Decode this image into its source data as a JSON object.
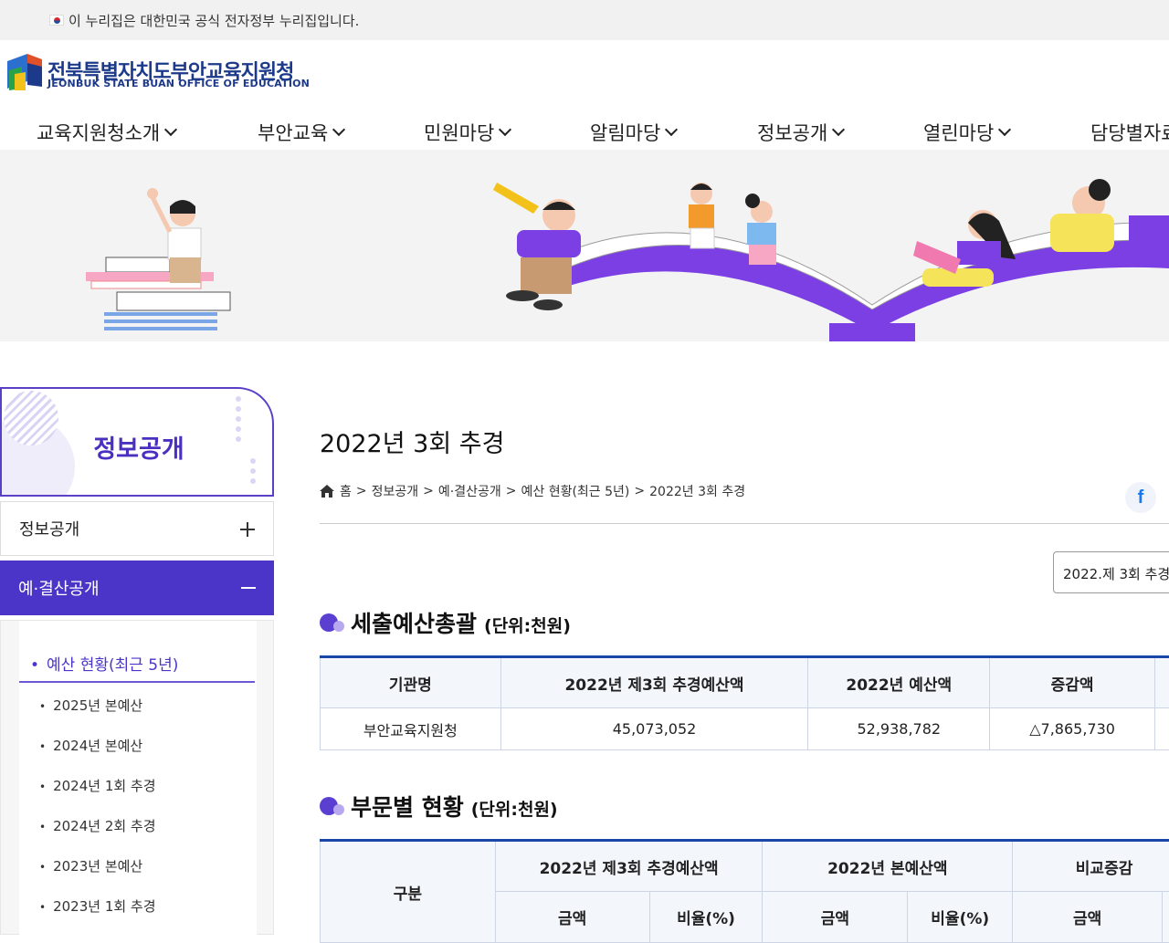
{
  "gov_banner": {
    "text": "이 누리집은 대한민국 공식 전자정부 누리집입니다."
  },
  "logo": {
    "name": "전북특별자치도부안교육지원청",
    "name_en": "JEONBUK STATE BUAN OFFICE OF EDUCATION"
  },
  "gnb": [
    {
      "label": "교육지원청소개"
    },
    {
      "label": "부안교육"
    },
    {
      "label": "민원마당"
    },
    {
      "label": "알림마당"
    },
    {
      "label": "정보공개"
    },
    {
      "label": "열린마당"
    },
    {
      "label": "담당별자료"
    }
  ],
  "lnb": {
    "title": "정보공개",
    "depth1": {
      "label": "정보공개"
    },
    "depth1_active": {
      "label": "예·결산공개"
    },
    "sub_active": "예산 현황(최근 5년)",
    "sub_items": [
      "2025년 본예산",
      "2024년 본예산",
      "2024년 1회 추경",
      "2024년 2회 추경",
      "2023년 본예산",
      "2023년 1회 추경"
    ]
  },
  "page": {
    "title": "2022년 3회 추경",
    "breadcrumb": [
      "홈",
      "정보공개",
      "예·결산공개",
      "예산 현황(최근 5년)",
      "2022년 3회 추경"
    ],
    "facebook_glyph": "f",
    "select_value": "2022.제 3회 추경"
  },
  "section1": {
    "title": "세출예산총괄",
    "unit": "(단위:천원)",
    "headers": [
      "기관명",
      "2022년 제3회 추경예산액",
      "2022년 예산액",
      "증감액",
      ""
    ],
    "row": [
      "부안교육지원청",
      "45,073,052",
      "52,938,782",
      "△7,865,730",
      ""
    ]
  },
  "section2": {
    "title": "부문별 현황",
    "unit": "(단위:천원)",
    "header_rowspan": "구분",
    "group_headers": [
      "2022년 제3회 추경예산액",
      "2022년 본예산액",
      "비교증감"
    ],
    "sub_headers": [
      "금액",
      "비율(%)",
      "금액",
      "비율(%)",
      "금액"
    ]
  },
  "colors": {
    "brand_purple": "#4a35c8",
    "table_top_border": "#1a46a8",
    "logo_navy": "#1d3a8a"
  }
}
